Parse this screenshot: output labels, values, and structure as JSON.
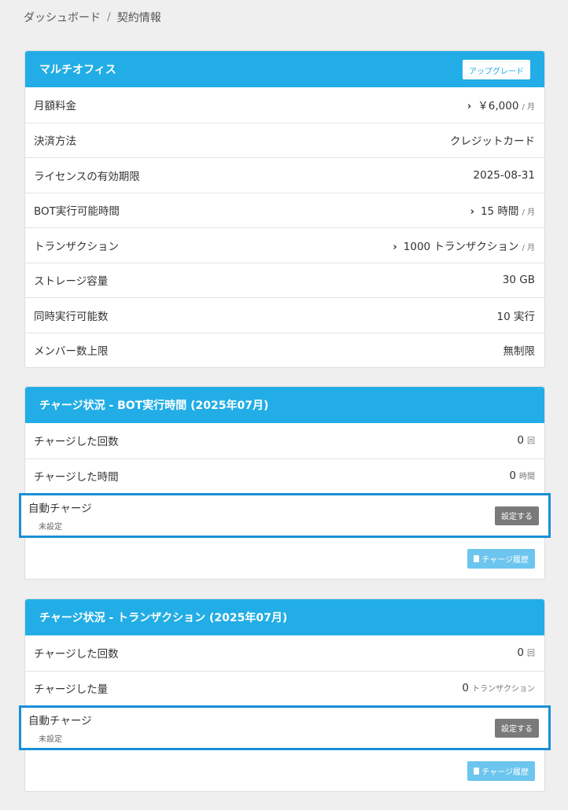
{
  "breadcrumb": {
    "home": "ダッシュボード",
    "separator": "/",
    "current": "契約情報"
  },
  "plan_card": {
    "title": "マルチオフィス",
    "upgrade_label": "アップグレード",
    "rows": [
      {
        "label": "月額料金",
        "value": "￥6,000",
        "unit": "/ 月",
        "chevron": true
      },
      {
        "label": "決済方法",
        "value": "クレジットカード",
        "unit": "",
        "chevron": false
      },
      {
        "label": "ライセンスの有効期限",
        "value": "2025-08-31",
        "unit": "",
        "chevron": false
      },
      {
        "label": "BOT実行可能時間",
        "value": "15 時間",
        "unit": "/ 月",
        "chevron": true
      },
      {
        "label": "トランザクション",
        "value": "1000 トランザクション",
        "unit": "/ 月",
        "chevron": true
      },
      {
        "label": "ストレージ容量",
        "value": "30 GB",
        "unit": "",
        "chevron": false
      },
      {
        "label": "同時実行可能数",
        "value": "10 実行",
        "unit": "",
        "chevron": false
      },
      {
        "label": "メンバー数上限",
        "value": "無制限",
        "unit": "",
        "chevron": false
      }
    ]
  },
  "bot_charge_card": {
    "title": "チャージ状況 - BOT実行時間 (2025年07月)",
    "rows": [
      {
        "label": "チャージした回数",
        "value": "0",
        "unit": "回"
      },
      {
        "label": "チャージした時間",
        "value": "0",
        "unit": "時間"
      }
    ],
    "auto_charge": {
      "label": "自動チャージ",
      "status": "未設定",
      "button": "設定する"
    },
    "history_label": "チャージ履歴"
  },
  "tx_charge_card": {
    "title": "チャージ状況 - トランザクション (2025年07月)",
    "rows": [
      {
        "label": "チャージした回数",
        "value": "0",
        "unit": "回"
      },
      {
        "label": "チャージした量",
        "value": "0",
        "unit": "トランザクション"
      }
    ],
    "auto_charge": {
      "label": "自動チャージ",
      "status": "未設定",
      "button": "設定する"
    },
    "history_label": "チャージ履歴"
  },
  "colors": {
    "header_bg": "#22ade6",
    "highlight_border": "#1a8fd6",
    "set_button_bg": "#7a7a7a",
    "history_button_bg": "#6cc5ee"
  },
  "icons": {
    "chevron": "chevron-right-icon",
    "history": "document-icon"
  }
}
